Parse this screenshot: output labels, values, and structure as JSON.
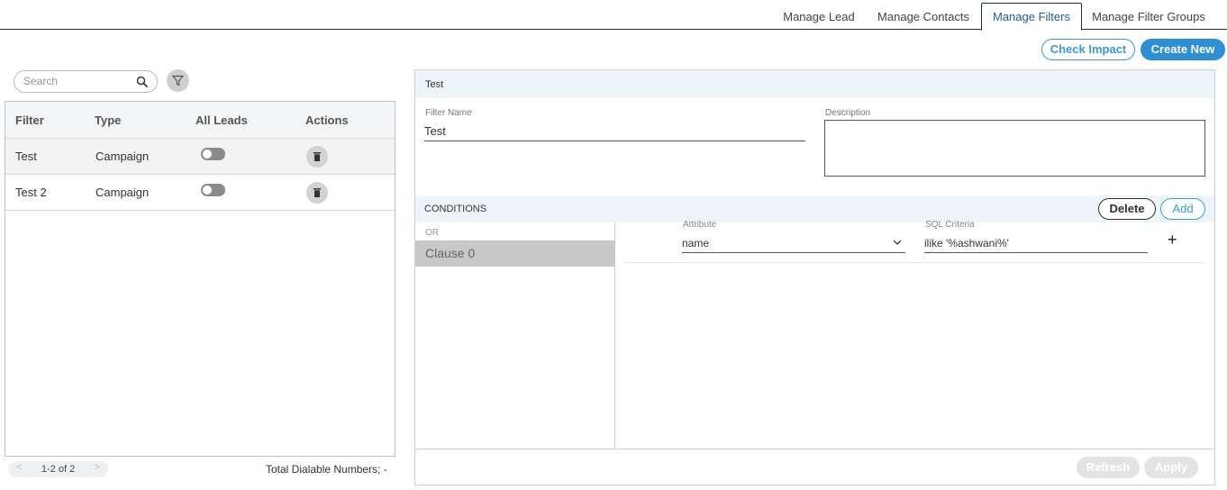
{
  "tabs": {
    "manage_lead": "Manage Lead",
    "manage_contacts": "Manage Contacts",
    "manage_filters": "Manage Filters",
    "manage_filter_groups": "Manage Filter Groups"
  },
  "actions": {
    "check_impact": "Check Impact",
    "create_new": "Create New"
  },
  "search": {
    "placeholder": "Search"
  },
  "table": {
    "headers": {
      "filter": "Filter",
      "type": "Type",
      "all_leads": "All Leads",
      "actions": "Actions"
    },
    "rows": [
      {
        "filter": "Test",
        "type": "Campaign",
        "all_leads": false
      },
      {
        "filter": "Test 2",
        "type": "Campaign",
        "all_leads": false
      }
    ]
  },
  "pager": {
    "prev": "<",
    "text": "1-2 of 2",
    "next": ">"
  },
  "total_dialable": "Total Dialable Numbers; -",
  "panel": {
    "title": "Test",
    "filter_name_label": "Filter Name",
    "filter_name_value": "Test",
    "description_label": "Description",
    "description_value": "",
    "conditions_title": "CONDITIONS",
    "delete_label": "Delete",
    "add_label": "Add",
    "or_label": "OR",
    "clause_label": "Clause 0",
    "attribute_label": "Attribute",
    "attribute_value": "name",
    "sql_label": "SQL Criteria",
    "sql_value": "ilike '%ashwani%'",
    "plus": "+",
    "refresh_label": "Refresh",
    "apply_label": "Apply"
  },
  "colors": {
    "accent": "#2d8fd5",
    "header_bg": "#eef5f8",
    "active_tab_text": "#1f5d99"
  }
}
